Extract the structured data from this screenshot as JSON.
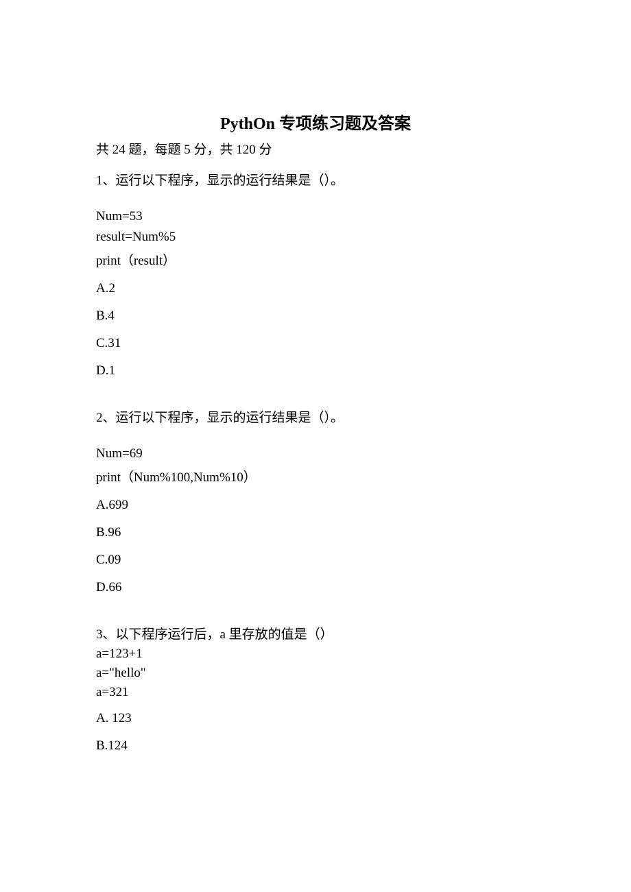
{
  "title": "PythOn 专项练习题及答案",
  "meta": "共 24 题，每题 5 分，共 120 分",
  "q1": {
    "stem": "1、运行以下程序，显示的运行结果是（）。",
    "code1": "Num=53",
    "code2": "result=Num%5",
    "code3": "print（result）",
    "optA": "A.2",
    "optB": "B.4",
    "optC": "C.31",
    "optD": "D.1"
  },
  "q2": {
    "stem": "2、运行以下程序，显示的运行结果是（）。",
    "code1": "Num=69",
    "code2": "print（Num%100,Num%10）",
    "optA": "A.699",
    "optB": "B.96",
    "optC": "C.09",
    "optD": "D.66"
  },
  "q3": {
    "stem": "3、以下程序运行后，a 里存放的值是（）",
    "code1": "a=123+1",
    "code2": "a=\"hello\"",
    "code3": "a=321",
    "optA": "A.   123",
    "optB": "B.124"
  }
}
